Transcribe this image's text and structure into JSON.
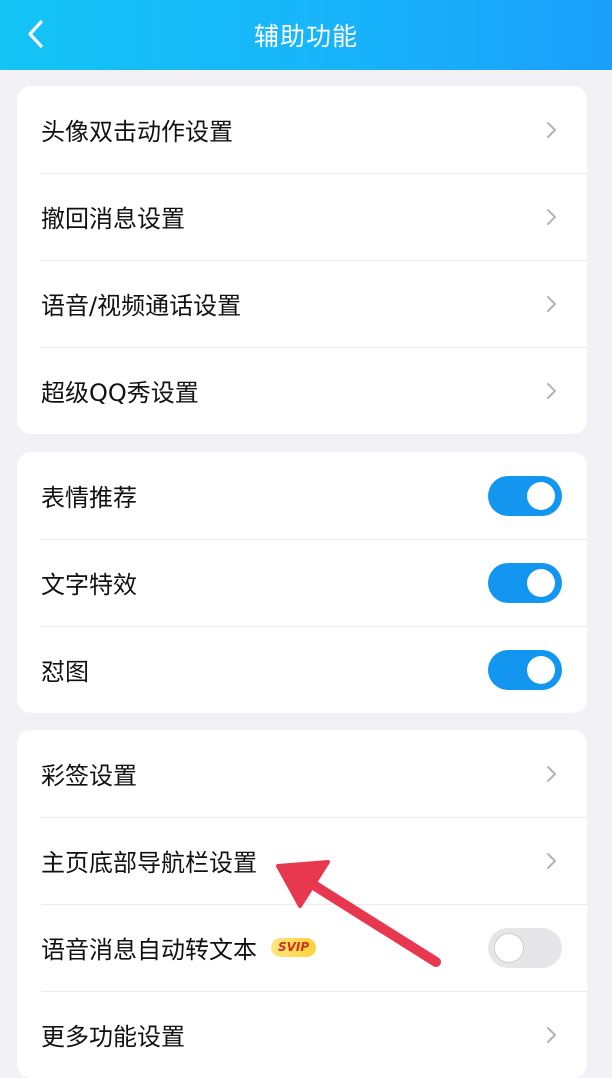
{
  "header": {
    "title": "辅助功能",
    "back_icon": "chevron-left-icon"
  },
  "group1": {
    "items": [
      {
        "label": "头像双击动作设置"
      },
      {
        "label": "撤回消息设置"
      },
      {
        "label": "语音/视频通话设置"
      },
      {
        "label": "超级QQ秀设置"
      }
    ]
  },
  "group2": {
    "items": [
      {
        "label": "表情推荐",
        "enabled": true
      },
      {
        "label": "文字特效",
        "enabled": true
      },
      {
        "label": "怼图",
        "enabled": true
      }
    ]
  },
  "group3": {
    "items": [
      {
        "label": "彩签设置"
      },
      {
        "label": "主页底部导航栏设置"
      },
      {
        "label": "语音消息自动转文本",
        "badge": "SVIP",
        "enabled": false
      },
      {
        "label": "更多功能设置"
      }
    ]
  },
  "colors": {
    "header_gradient_start": "#13c4f5",
    "header_gradient_end": "#1a9ffa",
    "toggle_on": "#1296f0",
    "toggle_off": "#e6e6e9",
    "annotation_arrow": "#e8384f"
  }
}
